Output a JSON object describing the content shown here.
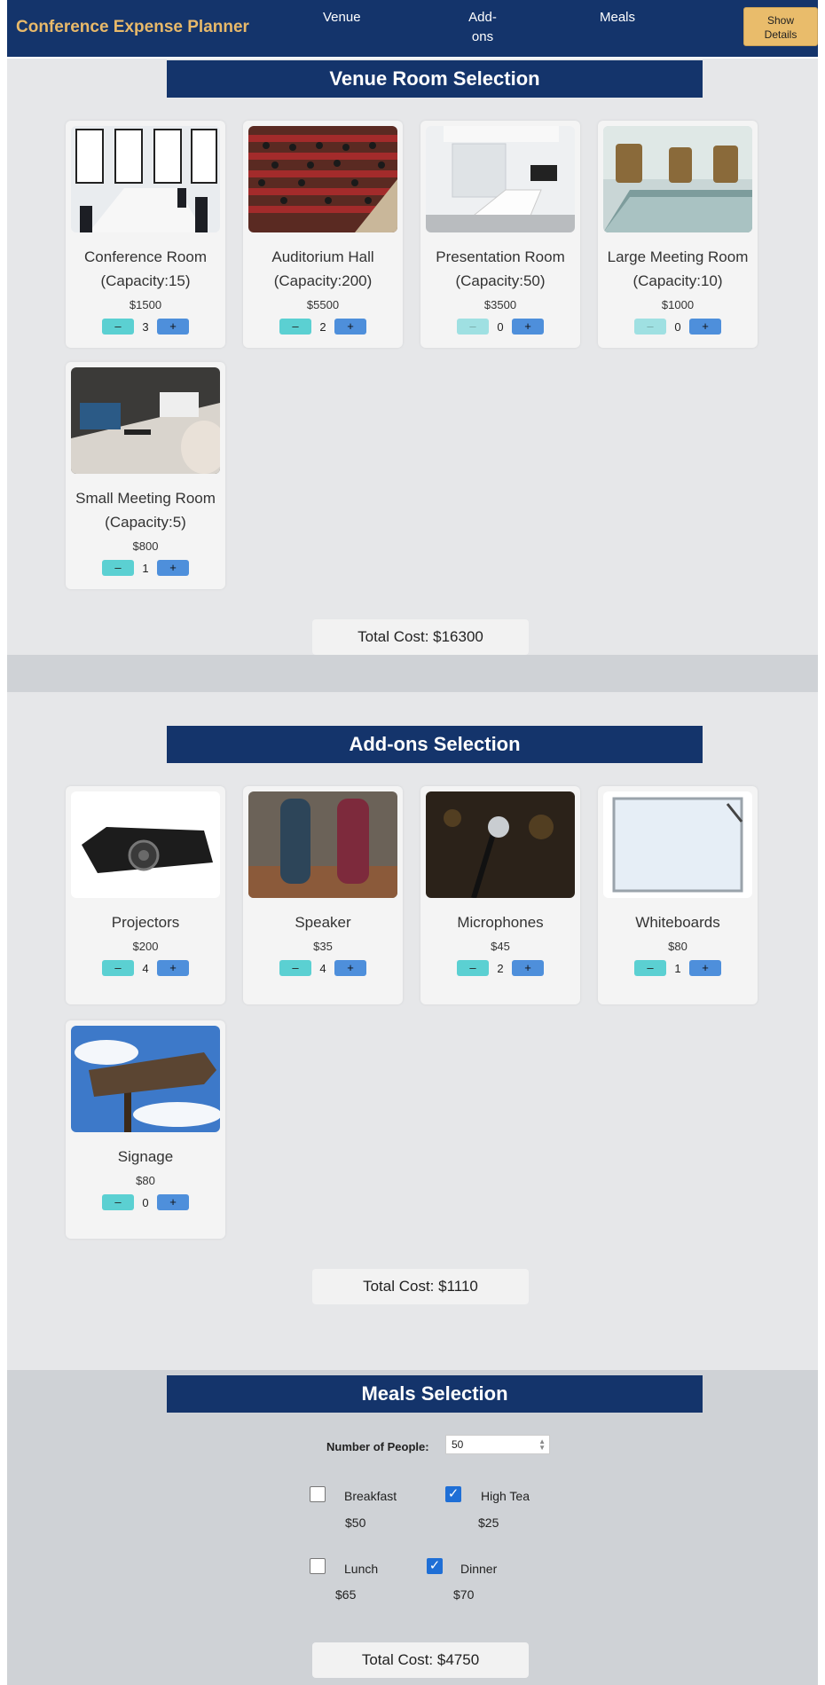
{
  "nav": {
    "brand": "Conference Expense Planner",
    "links": [
      "Venue",
      "Add-\nons",
      "Meals"
    ],
    "show_details": "Show\nDetails"
  },
  "venue": {
    "title": "Venue Room Selection",
    "items": [
      {
        "name": "Conference Room\n(Capacity:15)",
        "price": "$1500",
        "qty": "3",
        "icon": "conference-room-photo"
      },
      {
        "name": "Auditorium Hall\n(Capacity:200)",
        "price": "$5500",
        "qty": "2",
        "icon": "auditorium-photo"
      },
      {
        "name": "Presentation Room\n(Capacity:50)",
        "price": "$3500",
        "qty": "0",
        "icon": "presentation-room-photo"
      },
      {
        "name": "Large Meeting Room\n(Capacity:10)",
        "price": "$1000",
        "qty": "0",
        "icon": "large-meeting-room-photo"
      },
      {
        "name": "Small Meeting Room\n(Capacity:5)",
        "price": "$800",
        "qty": "1",
        "icon": "small-meeting-room-photo"
      }
    ],
    "total": "Total Cost: $16300"
  },
  "addons": {
    "title": "Add-ons Selection",
    "items": [
      {
        "name": "Projectors",
        "price": "$200",
        "qty": "4",
        "icon": "projector-photo"
      },
      {
        "name": "Speaker",
        "price": "$35",
        "qty": "4",
        "icon": "speaker-photo"
      },
      {
        "name": "Microphones",
        "price": "$45",
        "qty": "2",
        "icon": "microphone-photo"
      },
      {
        "name": "Whiteboards",
        "price": "$80",
        "qty": "1",
        "icon": "whiteboard-photo"
      },
      {
        "name": "Signage",
        "price": "$80",
        "qty": "0",
        "icon": "signage-photo"
      }
    ],
    "total": "Total Cost: $1110"
  },
  "meals": {
    "title": "Meals Selection",
    "people_label": "Number of People:",
    "people_value": "50",
    "items": [
      {
        "name": "Breakfast",
        "price": "$50",
        "checked": false
      },
      {
        "name": "High Tea",
        "price": "$25",
        "checked": true
      },
      {
        "name": "Lunch",
        "price": "$65",
        "checked": false
      },
      {
        "name": "Dinner",
        "price": "$70",
        "checked": true
      }
    ],
    "total": "Total Cost: $4750"
  },
  "stepper": {
    "minus": "–",
    "plus": "+"
  },
  "colors": {
    "navy": "#14346b",
    "gold": "#e8b96a",
    "minus_btn": "#5bd0d2",
    "plus_btn": "#4e8fdb",
    "check": "#1f6fd6"
  }
}
